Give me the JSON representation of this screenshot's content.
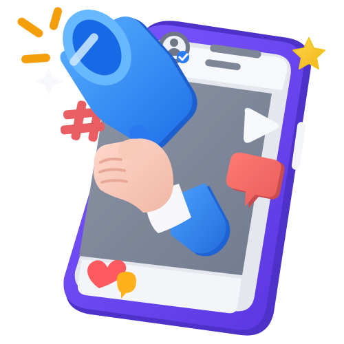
{
  "scene": {
    "icons": [
      "smartphone",
      "verified-user-avatar",
      "megaphone",
      "hashtag",
      "play-icon",
      "comment-bubble",
      "heart",
      "chat-bubble",
      "sparkle-star"
    ]
  },
  "colors": {
    "phone_frame": "#6B46E8",
    "phone_frame_dark": "#4F2FD0",
    "screen": "#7E8798",
    "screen_top": "#F3F4F8",
    "megaphone_blue": "#1F78F2",
    "megaphone_light": "#4EA6FF",
    "hand_skin": "#F7C8B8",
    "cuff": "#F7F7FB",
    "hashtag_red": "#E95E63",
    "comment_red": "#F06A66",
    "heart_red": "#FF5A5F",
    "chat_yellow": "#FFB11C",
    "star_yellow": "#F6C62A",
    "ray_orange": "#F59E0B",
    "verified_blue": "#2A7BF6"
  }
}
